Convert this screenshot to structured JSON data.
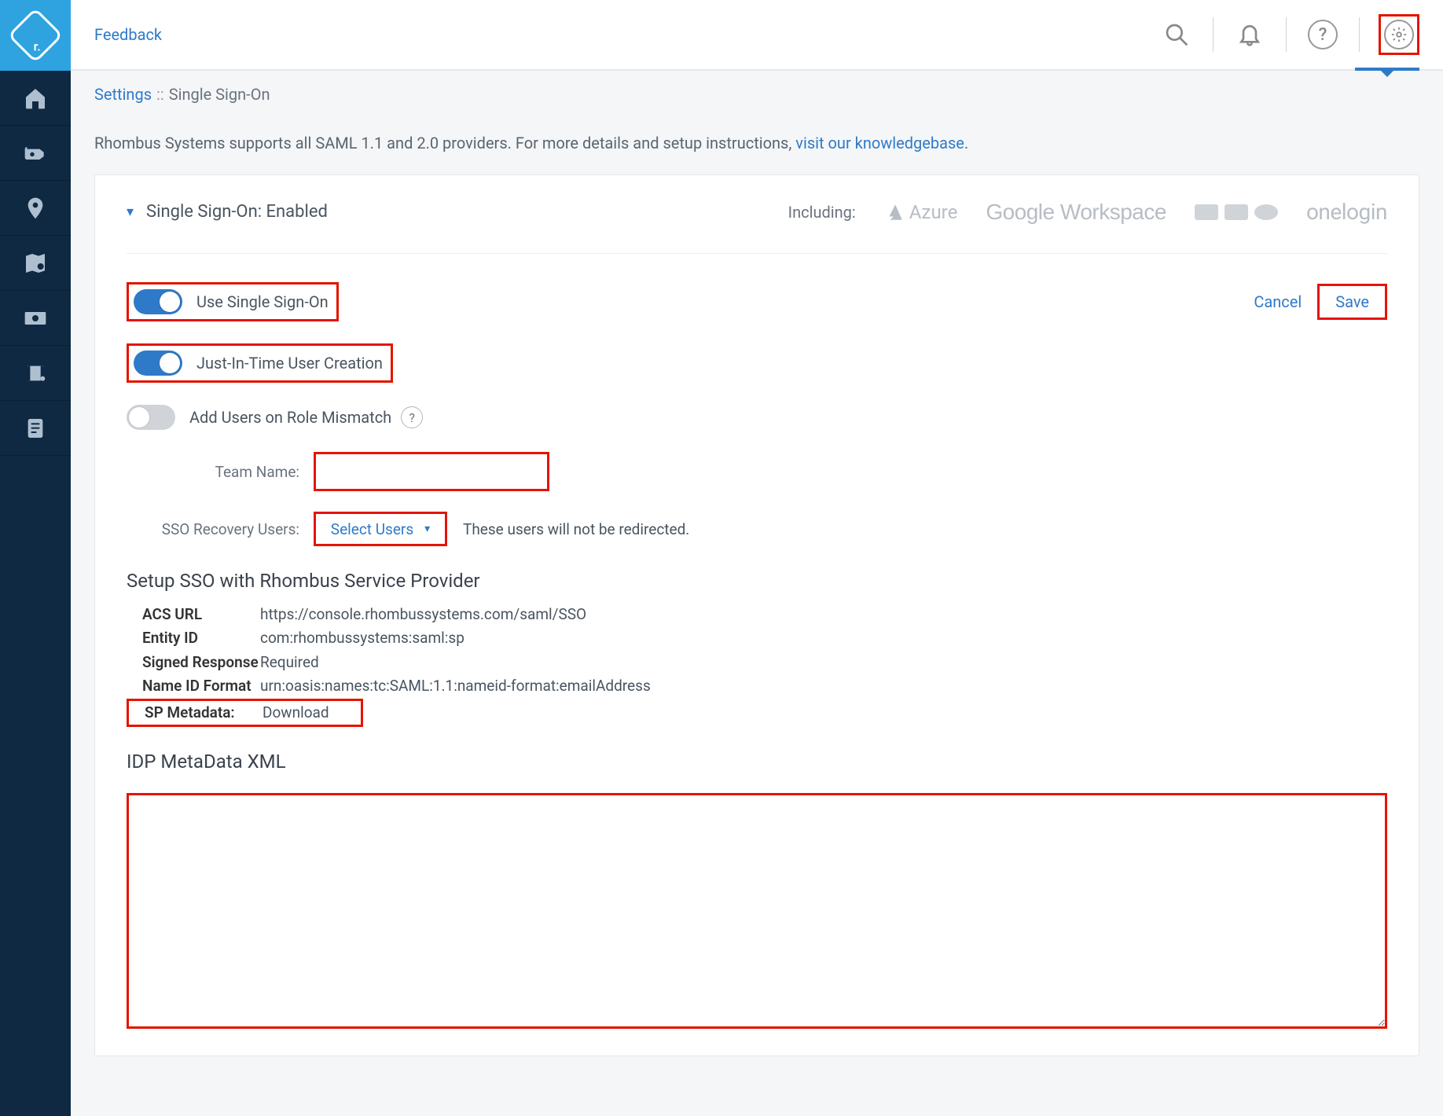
{
  "topbar": {
    "feedback": "Feedback"
  },
  "breadcrumb": {
    "settings": "Settings",
    "sep": "::",
    "current": "Single Sign-On"
  },
  "info": {
    "text_pre": "Rhombus Systems supports all SAML 1.1 and 2.0 providers. For more details and setup instructions, ",
    "link": "visit our knowledgebase",
    "text_post": "."
  },
  "panel": {
    "title": "Single Sign-On: Enabled",
    "including": "Including:",
    "providers": {
      "azure": "Azure",
      "google": "Google Workspace",
      "onelogin": "onelogin"
    },
    "toggles": {
      "use_sso": "Use Single Sign-On",
      "jit": "Just-In-Time User Creation",
      "role_mismatch": "Add Users on Role Mismatch"
    },
    "actions": {
      "cancel": "Cancel",
      "save": "Save"
    },
    "form": {
      "team_name_label": "Team Name:",
      "team_name_value": "",
      "recovery_label": "SSO Recovery Users:",
      "select_users": "Select Users",
      "recovery_hint": "These users will not be redirected."
    },
    "sp": {
      "title": "Setup SSO with Rhombus Service Provider",
      "acs_url_k": "ACS URL",
      "acs_url_v": "https://console.rhombussystems.com/saml/SSO",
      "entity_k": "Entity ID",
      "entity_v": "com:rhombussystems:saml:sp",
      "signed_k": "Signed Response",
      "signed_v": "Required",
      "nameid_k": "Name ID Format",
      "nameid_v": "urn:oasis:names:tc:SAML:1.1:nameid-format:emailAddress",
      "meta_k": "SP Metadata:",
      "meta_v": "Download"
    },
    "idp_title": "IDP MetaData XML",
    "idp_value": ""
  }
}
